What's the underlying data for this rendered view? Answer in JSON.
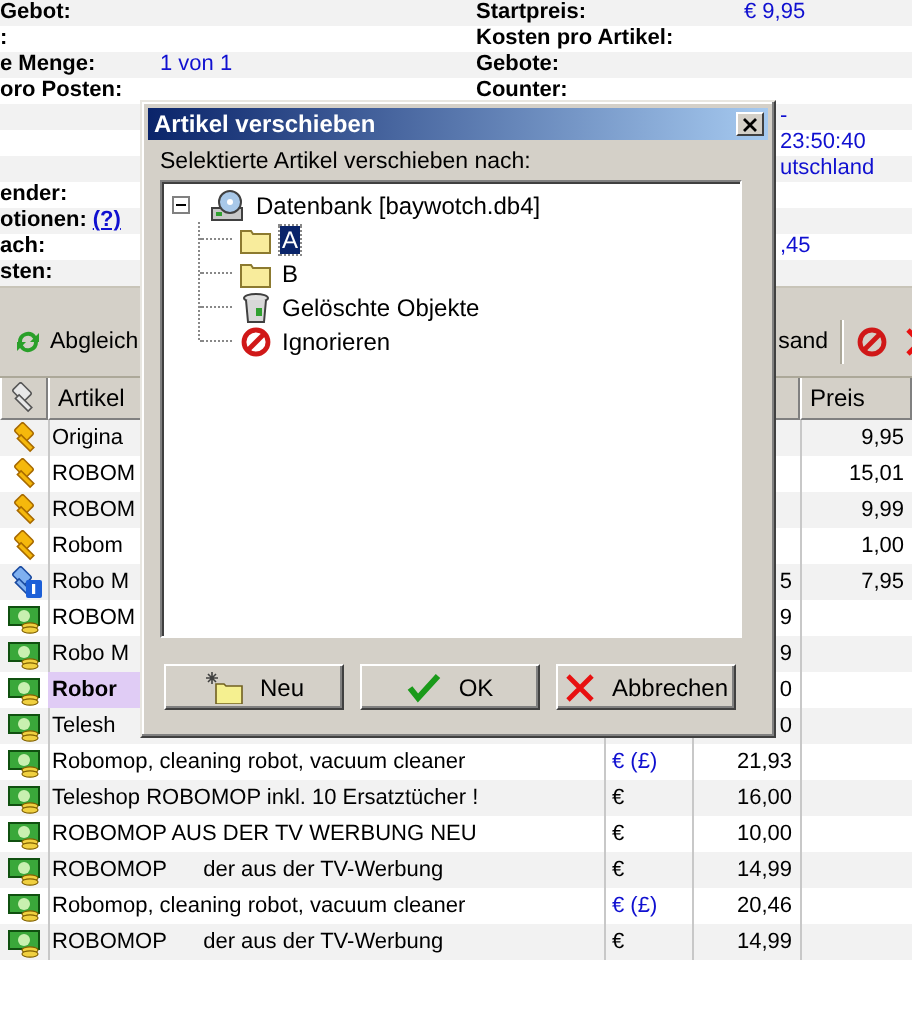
{
  "info_rows": [
    {
      "label": "Gebot:",
      "right_label": "Startpreis:",
      "right_value": "€ 9,95"
    },
    {
      "label": ":",
      "right_label": "Kosten pro Artikel:"
    },
    {
      "label": "e Menge:",
      "value": "1 von 1",
      "right_label": "Gebote:"
    },
    {
      "label": "oro Posten:",
      "right_label": "Counter:"
    },
    {
      "right_value": "-"
    },
    {
      "right_value": "23:50:40"
    },
    {
      "right_value": "utschland"
    },
    {
      "label": "ender:"
    },
    {
      "label": "otionen:",
      "help_link": "(?)"
    },
    {
      "label": "ach:",
      "right_value": ",45"
    },
    {
      "label": "sten:"
    }
  ],
  "toolbar": {
    "left": [
      {
        "kind": "sync",
        "label": "Abgleich"
      }
    ],
    "right": [
      {
        "kind": "text",
        "label": "sand"
      },
      {
        "kind": "block"
      },
      {
        "kind": "delete"
      }
    ]
  },
  "table": {
    "columns": [
      {
        "kind": "icon"
      },
      {
        "kind": "text",
        "label": "Artikel"
      },
      {
        "kind": "text"
      },
      {
        "kind": "text",
        "label": "Preis"
      }
    ],
    "rows": [
      {
        "kind": "auction",
        "title": "Origina",
        "selected": false,
        "price": "9,95"
      },
      {
        "kind": "auction",
        "title": "ROBOM",
        "selected": false,
        "price": "15,01"
      },
      {
        "kind": "auction",
        "title": "ROBOM",
        "selected": false,
        "price": "9,99"
      },
      {
        "kind": "auction",
        "title": "Robom",
        "selected": false,
        "price": "1,00"
      },
      {
        "kind": "multi",
        "title": "Robo M",
        "selected": false,
        "bid": "5",
        "price": "7,95"
      },
      {
        "kind": "fixed",
        "title": "ROBOM",
        "selected": false,
        "bid": "9"
      },
      {
        "kind": "fixed",
        "title": "Robo M",
        "selected": false,
        "bid": "9"
      },
      {
        "kind": "fixed",
        "title": "Robor",
        "selected": true,
        "bid": "0"
      },
      {
        "kind": "fixed",
        "title": "Telesh",
        "selected": false,
        "bid": "0"
      },
      {
        "kind": "fixed",
        "title": "Robomop, cleaning robot, vacuum cleaner",
        "selected": false,
        "currency": "€ (£)",
        "converted": true,
        "bid": "21,93"
      },
      {
        "kind": "fixed",
        "title": "Teleshop ROBOMOP inkl. 10 Ersatztücher !",
        "selected": false,
        "currency": "€",
        "converted": false,
        "bid": "16,00"
      },
      {
        "kind": "fixed",
        "title": "ROBOMOP AUS DER TV WERBUNG NEU",
        "selected": false,
        "currency": "€",
        "converted": false,
        "bid": "10,00"
      },
      {
        "kind": "fixed",
        "title": "ROBOMOP      der aus der TV-Werbung",
        "selected": false,
        "currency": "€",
        "converted": false,
        "bid": "14,99"
      },
      {
        "kind": "fixed",
        "title": "Robomop, cleaning robot, vacuum cleaner",
        "selected": false,
        "currency": "€ (£)",
        "converted": true,
        "bid": "20,46"
      },
      {
        "kind": "fixed",
        "title": "ROBOMOP      der aus der TV-Werbung",
        "selected": false,
        "currency": "€",
        "converted": false,
        "bid": "14,99"
      }
    ]
  },
  "dialog": {
    "title": "Artikel verschieben",
    "prompt": "Selektierte Artikel verschieben nach:",
    "tree": {
      "label": "Datenbank [baywotch.db4]",
      "expanded": true,
      "selected": false,
      "children": [
        {
          "label": "A",
          "kind": "folder",
          "selected": true
        },
        {
          "label": "B",
          "kind": "folder",
          "selected": false
        },
        {
          "label": "Gelöschte Objekte",
          "kind": "trash",
          "selected": false
        },
        {
          "label": "Ignorieren",
          "kind": "ignore",
          "selected": false
        }
      ]
    },
    "buttons": [
      {
        "kind": "new",
        "label": "Neu"
      },
      {
        "kind": "ok",
        "label": "OK"
      },
      {
        "kind": "cancel",
        "label": "Abbrechen"
      }
    ]
  }
}
